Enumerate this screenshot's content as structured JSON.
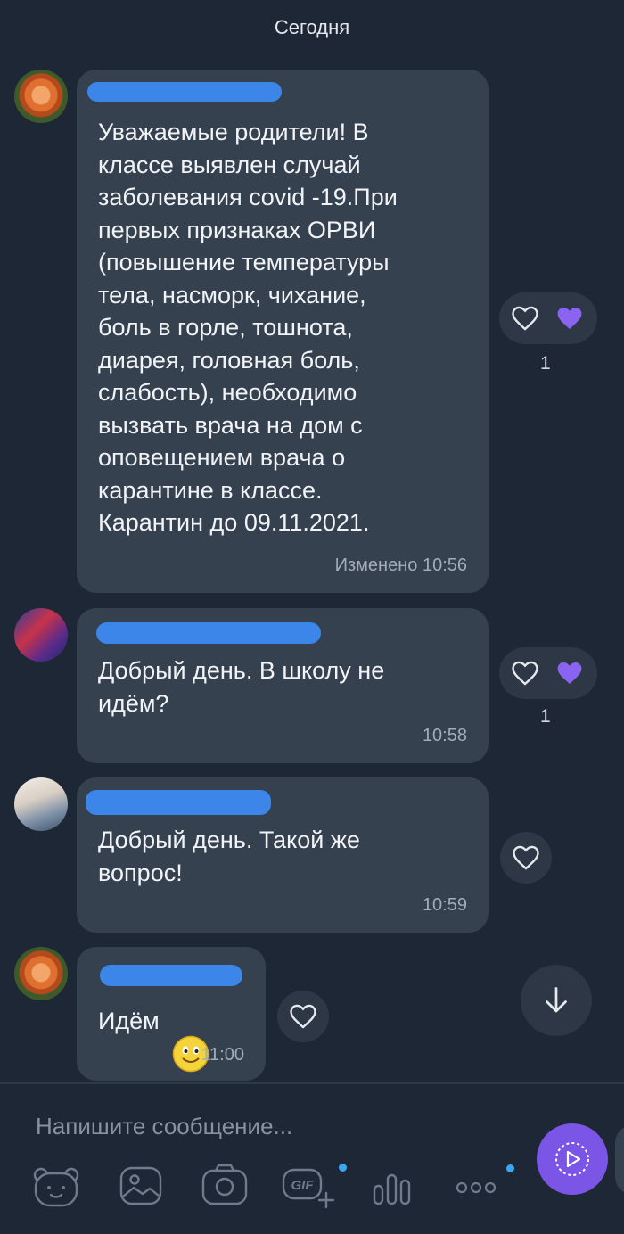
{
  "date_separator": "Сегодня",
  "messages": [
    {
      "text": "Уважаемые родители! В\nклассе выявлен случай\nзаболевания covid -19.При\nпервых признаках ОРВИ\n(повышение температуры\nтела, насморк, чихание,\nболь в горле, тошнота,\nдиарея, головная боль,\nслабость), необходимо\nвызвать  врача на дом с\nоповещением  врача о\nкарантине в классе.\nКарантин до 09.11.2021.",
      "time": "Изменено  10:56",
      "likes": "1"
    },
    {
      "text": "Добрый день. В школу не\nидём?",
      "time": "10:58",
      "likes": "1"
    },
    {
      "text": "Добрый день. Такой же\nвопрос!",
      "time": "10:59"
    },
    {
      "text": "Идём",
      "emoji": "🙂",
      "time": "11:00"
    }
  ],
  "composer": {
    "placeholder": "Напишите сообщение..."
  },
  "icons": {
    "like": "heart-outline-icon",
    "liked": "heart-filled-icon",
    "scroll_down": "arrow-down-icon",
    "toolbar": [
      "sticker-icon",
      "gallery-icon",
      "camera-icon",
      "gif-icon",
      "poll-icon",
      "more-icon"
    ],
    "send": "play-circle-icon"
  },
  "colors": {
    "background": "#1e2735",
    "bubble": "#364150",
    "accent": "#7a55e6",
    "liked_heart": "#8a63f0",
    "notification_dot": "#3aa7f0"
  }
}
